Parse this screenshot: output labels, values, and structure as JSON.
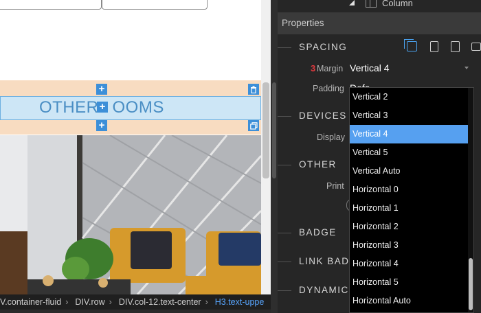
{
  "canvas": {
    "heading_text": "OTHER ROOMS",
    "heading_left": "OTHER",
    "heading_right": "OOMS"
  },
  "breadcrumb": [
    {
      "label": "V.container-fluid",
      "sep": "›"
    },
    {
      "label": "DIV.row",
      "sep": "›"
    },
    {
      "label": "DIV.col-12.text-center",
      "sep": "›"
    },
    {
      "label": "H3.text-uppe",
      "sep": ""
    }
  ],
  "panel": {
    "column_label": "Column",
    "properties_title": "Properties",
    "sections": {
      "spacing": "SPACING",
      "devices": "DEVICES",
      "other": "OTHER",
      "badge": "BADGE",
      "link_badge": "LINK BAD",
      "dynamic": "DYNAMIC"
    },
    "margin": {
      "number": "3",
      "label": "Margin",
      "value": "Vertical 4"
    },
    "padding": {
      "label": "Padding",
      "value": "Defa"
    },
    "display_label": "Display",
    "print_label": "Print"
  },
  "dropdown": {
    "options": [
      "Vertical 2",
      "Vertical 3",
      "Vertical 4",
      "Vertical 5",
      "Vertical Auto",
      "Horizontal 0",
      "Horizontal 1",
      "Horizontal 2",
      "Horizontal 3",
      "Horizontal 4",
      "Horizontal 5",
      "Horizontal Auto"
    ],
    "selected": "Vertical 4"
  },
  "colors": {
    "selection_band": "#f8dcc1",
    "heading_box": "#cde6f6",
    "accent_blue": "#3d8fd8",
    "dropdown_selected": "#56a0f0",
    "margin_number_red": "#e0393e",
    "panel_bg": "#262626"
  },
  "icons": {
    "add": "plus-icon",
    "delete": "trash-icon",
    "clone": "duplicate-icon",
    "column": "column-icon",
    "devices": [
      "desktop-icon",
      "phone-icon",
      "tablet-icon",
      "laptop-icon"
    ]
  }
}
